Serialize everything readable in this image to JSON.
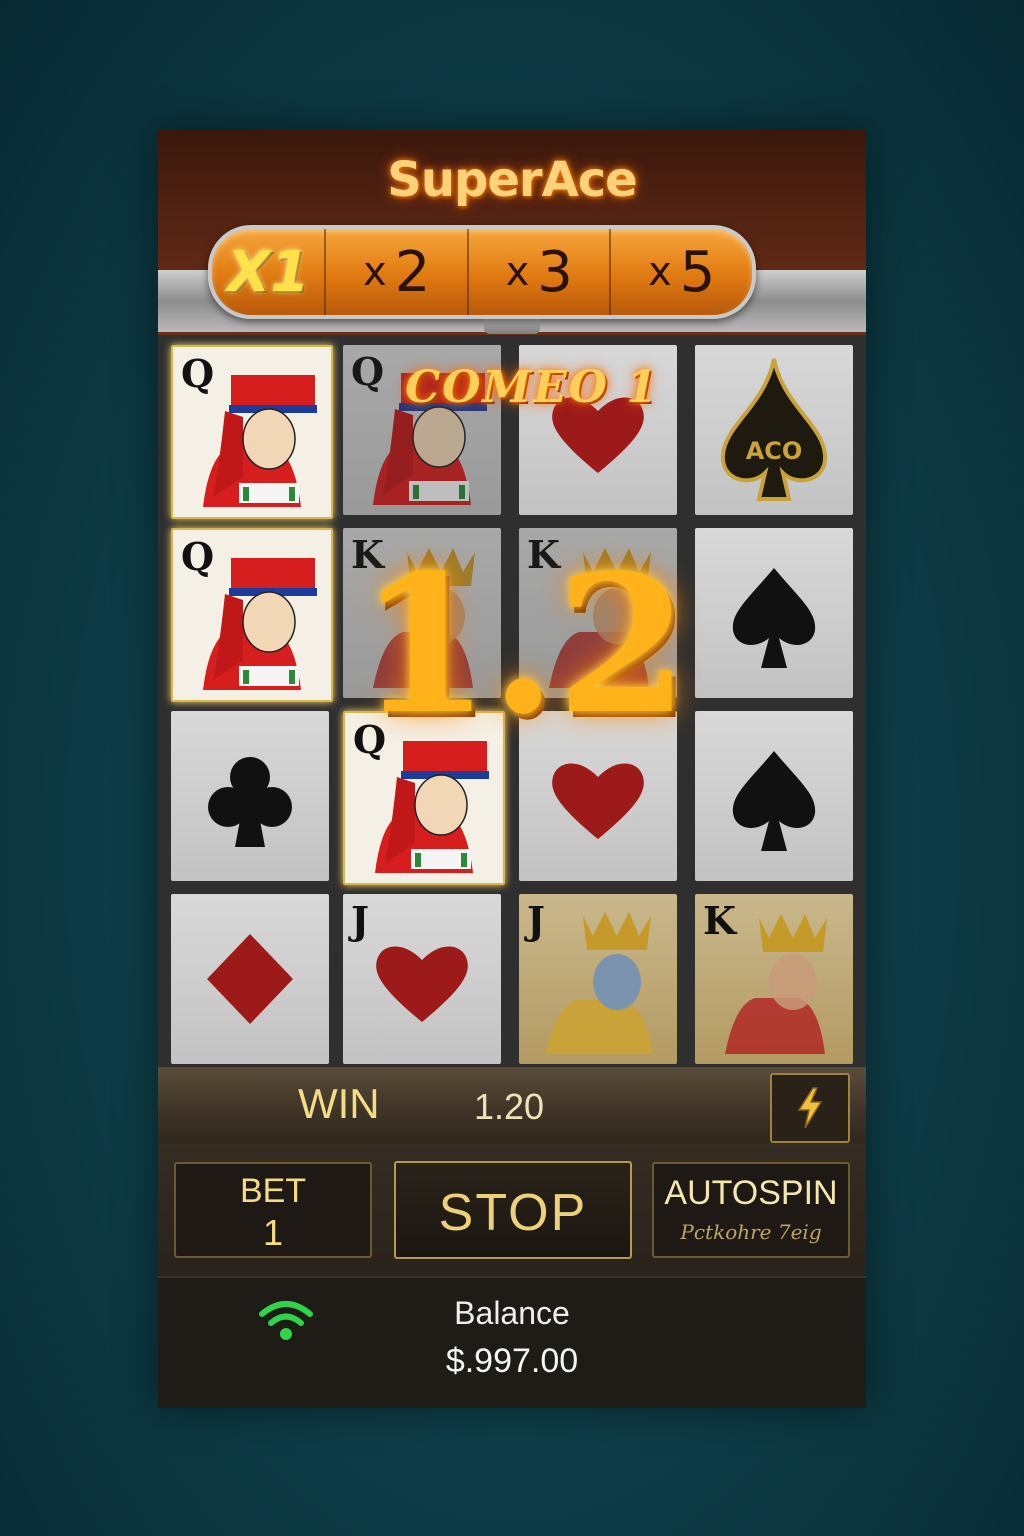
{
  "title": "SuperAce",
  "multipliers": [
    {
      "label": "X1",
      "active": true
    },
    {
      "x": "x",
      "num": "2",
      "active": false
    },
    {
      "x": "x",
      "num": "3",
      "active": false
    },
    {
      "x": "x",
      "num": "5",
      "active": false
    }
  ],
  "combo_text": "COMEO  1",
  "big_win_number": "1.2",
  "grid": {
    "cards": [
      {
        "rank": "Q",
        "kind": "queen",
        "row": 1,
        "col": 1
      },
      {
        "rank": "Q",
        "kind": "queen",
        "row": 1,
        "col": 2
      },
      {
        "rank": "",
        "kind": "heart",
        "row": 1,
        "col": 3
      },
      {
        "rank": "",
        "kind": "ace",
        "label": "ACO",
        "row": 1,
        "col": 4
      },
      {
        "rank": "Q",
        "kind": "queen",
        "row": 2,
        "col": 1
      },
      {
        "rank": "K",
        "kind": "king",
        "row": 2,
        "col": 2
      },
      {
        "rank": "K",
        "kind": "king",
        "row": 2,
        "col": 3
      },
      {
        "rank": "",
        "kind": "spade",
        "row": 2,
        "col": 4
      },
      {
        "rank": "",
        "kind": "club",
        "row": 3,
        "col": 1
      },
      {
        "rank": "Q",
        "kind": "queen",
        "row": 3,
        "col": 2
      },
      {
        "rank": "",
        "kind": "heart",
        "row": 3,
        "col": 3
      },
      {
        "rank": "",
        "kind": "spade",
        "row": 3,
        "col": 4
      },
      {
        "rank": "",
        "kind": "diamond",
        "row": 4,
        "col": 1
      },
      {
        "rank": "J",
        "kind": "heart",
        "row": 4,
        "col": 2
      },
      {
        "rank": "J",
        "kind": "jack",
        "row": 4,
        "col": 3
      },
      {
        "rank": "K",
        "kind": "king",
        "row": 4,
        "col": 4
      }
    ]
  },
  "win": {
    "label": "WIN",
    "value": "1.20"
  },
  "controls": {
    "bet_label": "BET",
    "bet_value": "1",
    "stop_label": "STOP",
    "autospin_label": "AUTOSPIN",
    "autospin_sub": "Pctkohre 7eig"
  },
  "footer": {
    "balance_label": "Balance",
    "balance_value": "$.997.00"
  },
  "colors": {
    "accent": "#f39a2a",
    "gold": "#f3dc86",
    "wifi": "#2fd44a"
  }
}
